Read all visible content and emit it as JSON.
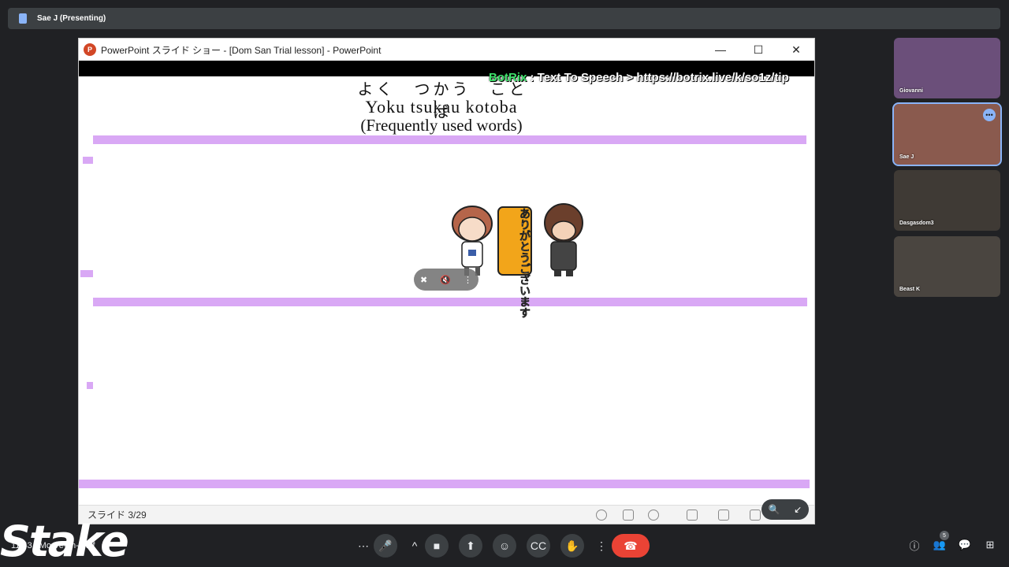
{
  "meet": {
    "presenter_label": "Sae J (Presenting)",
    "meeting_code": "11:43 | Mo Ve-jm-nxhf"
  },
  "ppt": {
    "window_title": "PowerPoint スライド ショー - [Dom San Trial lesson] - PowerPoint",
    "min_glyph": "—",
    "max_glyph": "☐",
    "close_glyph": "✕",
    "status_slide": "スライド 3/29"
  },
  "slide": {
    "title_jp": "よく　つかう　ことば",
    "title_romaji": "Yoku tsukau kotoba",
    "title_en": "(Frequently used words)",
    "mascot_text": "ありがとうございます",
    "accent_color": "#d9a8f5"
  },
  "overlay": {
    "botrix_brand": "BotRix",
    "botrix_text": ": Text To Speech > https://botrix.live/k/so1z/tip"
  },
  "participants": [
    {
      "name": "Giovanni",
      "color": "#6b4f7a"
    },
    {
      "name": "Sae J",
      "color": "#8a5a4e"
    },
    {
      "name": "Dasgasdom3",
      "color": "#3f3a35"
    },
    {
      "name": "Beast K",
      "color": "#4a4540"
    }
  ],
  "branding": {
    "stake": "Stake"
  },
  "controls": {
    "more_glyph": "⋯",
    "mic_glyph": "🎤",
    "caret_glyph": "^",
    "camera_glyph": "■",
    "present_glyph": "⬆",
    "emoji_glyph": "☺",
    "captions_glyph": "CC",
    "hand_glyph": "✋",
    "options_glyph": "⋮",
    "end_glyph": "☎",
    "info_glyph": "ⓘ",
    "people_glyph": "👥",
    "people_count": "5",
    "chat_glyph": "💬",
    "activities_glyph": "⊞"
  }
}
